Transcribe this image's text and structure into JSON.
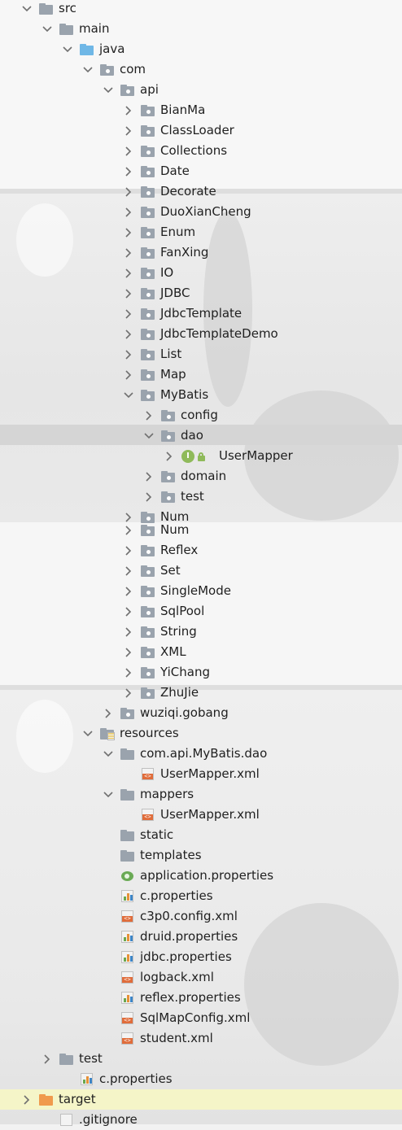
{
  "tree": {
    "rows": [
      {
        "label": "src",
        "icon": "folder-icon",
        "arrow": "expanded"
      },
      {
        "label": "main",
        "icon": "folder-icon",
        "arrow": "expanded"
      },
      {
        "label": "java",
        "icon": "source-folder-icon",
        "arrow": "expanded"
      },
      {
        "label": "com",
        "icon": "package-icon",
        "arrow": "expanded"
      },
      {
        "label": "api",
        "icon": "package-icon",
        "arrow": "expanded"
      },
      {
        "label": "BianMa",
        "icon": "package-icon",
        "arrow": "collapsed"
      },
      {
        "label": "ClassLoader",
        "icon": "package-icon",
        "arrow": "collapsed"
      },
      {
        "label": "Collections",
        "icon": "package-icon",
        "arrow": "collapsed"
      },
      {
        "label": "Date",
        "icon": "package-icon",
        "arrow": "collapsed"
      },
      {
        "label": "Decorate",
        "icon": "package-icon",
        "arrow": "collapsed"
      },
      {
        "label": "DuoXianCheng",
        "icon": "package-icon",
        "arrow": "collapsed"
      },
      {
        "label": "Enum",
        "icon": "package-icon",
        "arrow": "collapsed"
      },
      {
        "label": "FanXing",
        "icon": "package-icon",
        "arrow": "collapsed"
      },
      {
        "label": "IO",
        "icon": "package-icon",
        "arrow": "collapsed"
      },
      {
        "label": "JDBC",
        "icon": "package-icon",
        "arrow": "collapsed"
      },
      {
        "label": "JdbcTemplate",
        "icon": "package-icon",
        "arrow": "collapsed"
      },
      {
        "label": "JdbcTemplateDemo",
        "icon": "package-icon",
        "arrow": "collapsed"
      },
      {
        "label": "List",
        "icon": "package-icon",
        "arrow": "collapsed"
      },
      {
        "label": "Map",
        "icon": "package-icon",
        "arrow": "collapsed"
      },
      {
        "label": "MyBatis",
        "icon": "package-icon",
        "arrow": "expanded"
      },
      {
        "label": "config",
        "icon": "package-icon",
        "arrow": "collapsed"
      },
      {
        "label": "dao",
        "icon": "package-icon",
        "arrow": "expanded",
        "selected": true
      },
      {
        "label": "UserMapper",
        "icon": "interface-icon",
        "arrow": "collapsed"
      },
      {
        "label": "domain",
        "icon": "package-icon",
        "arrow": "collapsed"
      },
      {
        "label": "test",
        "icon": "package-icon",
        "arrow": "collapsed"
      },
      {
        "label": "Num",
        "icon": "package-icon",
        "arrow": "collapsed"
      },
      {
        "label": "Num",
        "icon": "package-icon",
        "arrow": "collapsed"
      },
      {
        "label": "Reflex",
        "icon": "package-icon",
        "arrow": "collapsed"
      },
      {
        "label": "Set",
        "icon": "package-icon",
        "arrow": "collapsed"
      },
      {
        "label": "SingleMode",
        "icon": "package-icon",
        "arrow": "collapsed"
      },
      {
        "label": "SqlPool",
        "icon": "package-icon",
        "arrow": "collapsed"
      },
      {
        "label": "String",
        "icon": "package-icon",
        "arrow": "collapsed"
      },
      {
        "label": "XML",
        "icon": "package-icon",
        "arrow": "collapsed"
      },
      {
        "label": "YiChang",
        "icon": "package-icon",
        "arrow": "collapsed"
      },
      {
        "label": "ZhuJie",
        "icon": "package-icon",
        "arrow": "collapsed"
      },
      {
        "label": "wuziqi.gobang",
        "icon": "package-icon",
        "arrow": "collapsed"
      },
      {
        "label": "resources",
        "icon": "resources-folder-icon",
        "arrow": "expanded"
      },
      {
        "label": "com.api.MyBatis.dao",
        "icon": "folder-icon",
        "arrow": "expanded"
      },
      {
        "label": "UserMapper.xml",
        "icon": "xml-file-icon",
        "arrow": "none"
      },
      {
        "label": "mappers",
        "icon": "folder-icon",
        "arrow": "expanded"
      },
      {
        "label": "UserMapper.xml",
        "icon": "xml-file-icon",
        "arrow": "none"
      },
      {
        "label": "static",
        "icon": "folder-icon",
        "arrow": "none"
      },
      {
        "label": "templates",
        "icon": "folder-icon",
        "arrow": "none"
      },
      {
        "label": "application.properties",
        "icon": "spring-properties-icon",
        "arrow": "none"
      },
      {
        "label": "c.properties",
        "icon": "properties-file-icon",
        "arrow": "none"
      },
      {
        "label": "c3p0.config.xml",
        "icon": "xml-file-icon",
        "arrow": "none"
      },
      {
        "label": "druid.properties",
        "icon": "properties-file-icon",
        "arrow": "none"
      },
      {
        "label": "jdbc.properties",
        "icon": "properties-file-icon",
        "arrow": "none"
      },
      {
        "label": "logback.xml",
        "icon": "xml-file-icon",
        "arrow": "none"
      },
      {
        "label": "reflex.properties",
        "icon": "properties-file-icon",
        "arrow": "none"
      },
      {
        "label": "SqlMapConfig.xml",
        "icon": "xml-file-icon",
        "arrow": "none"
      },
      {
        "label": "student.xml",
        "icon": "xml-file-icon",
        "arrow": "none"
      },
      {
        "label": "test",
        "icon": "folder-icon",
        "arrow": "collapsed"
      },
      {
        "label": "c.properties",
        "icon": "properties-file-icon",
        "arrow": "none"
      },
      {
        "label": "target",
        "icon": "excluded-folder-icon",
        "arrow": "collapsed"
      },
      {
        "label": ".gitignore",
        "icon": "gitignore-file-icon",
        "arrow": "none"
      }
    ]
  },
  "colors": {
    "selected_row": "#d5d5d5",
    "target_row": "#f5f5c8",
    "folder": "#9aa3ad",
    "source_folder": "#6fb7e6",
    "excluded_folder": "#f09a4d"
  }
}
